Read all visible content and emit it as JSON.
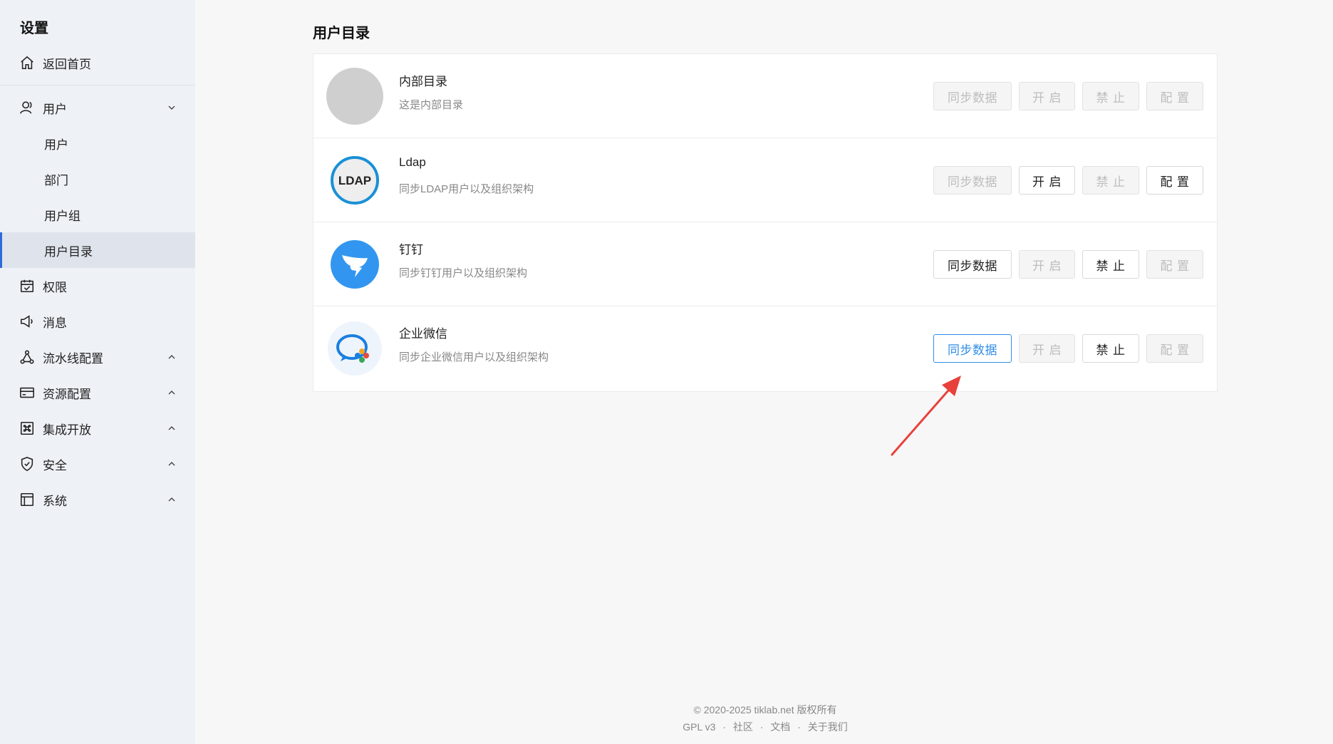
{
  "sidebar": {
    "title": "设置",
    "home": "返回首页",
    "user_group_label": "用户",
    "sub_items": [
      "用户",
      "部门",
      "用户组",
      "用户目录"
    ],
    "items": [
      {
        "label": "权限",
        "icon": "calendar-check-icon"
      },
      {
        "label": "消息",
        "icon": "megaphone-icon"
      },
      {
        "label": "流水线配置",
        "icon": "network-icon"
      },
      {
        "label": "资源配置",
        "icon": "card-icon"
      },
      {
        "label": "集成开放",
        "icon": "command-icon"
      },
      {
        "label": "安全",
        "icon": "shield-icon"
      },
      {
        "label": "系统",
        "icon": "layout-icon"
      }
    ]
  },
  "main": {
    "title": "用户目录",
    "directories": [
      {
        "name": "内部目录",
        "desc": "这是内部目录",
        "logo": "gray-circle",
        "sync": "同步数据",
        "open": "开 启",
        "ban": "禁 止",
        "conf": "配 置"
      },
      {
        "name": "Ldap",
        "desc": "同步LDAP用户以及组织架构",
        "logo": "LDAP",
        "sync": "同步数据",
        "open": "开 启",
        "ban": "禁 止",
        "conf": "配 置"
      },
      {
        "name": "钉钉",
        "desc": "同步钉钉用户以及组织架构",
        "logo": "dingtalk",
        "sync": "同步数据",
        "open": "开 启",
        "ban": "禁 止",
        "conf": "配 置"
      },
      {
        "name": "企业微信",
        "desc": "同步企业微信用户以及组织架构",
        "logo": "wecom",
        "sync": "同步数据",
        "open": "开 启",
        "ban": "禁 止",
        "conf": "配 置"
      }
    ]
  },
  "footer": {
    "copyright": "© 2020-2025 tiklab.net 版权所有",
    "license": "GPL v3",
    "community": "社区",
    "docs": "文档",
    "about": "关于我们",
    "dot": "·"
  },
  "colors": {
    "accent": "#2f8ee8",
    "arrow": "#e8413c",
    "sidebar_bg": "#eef1f6",
    "active_bar": "#2f6bd8"
  }
}
